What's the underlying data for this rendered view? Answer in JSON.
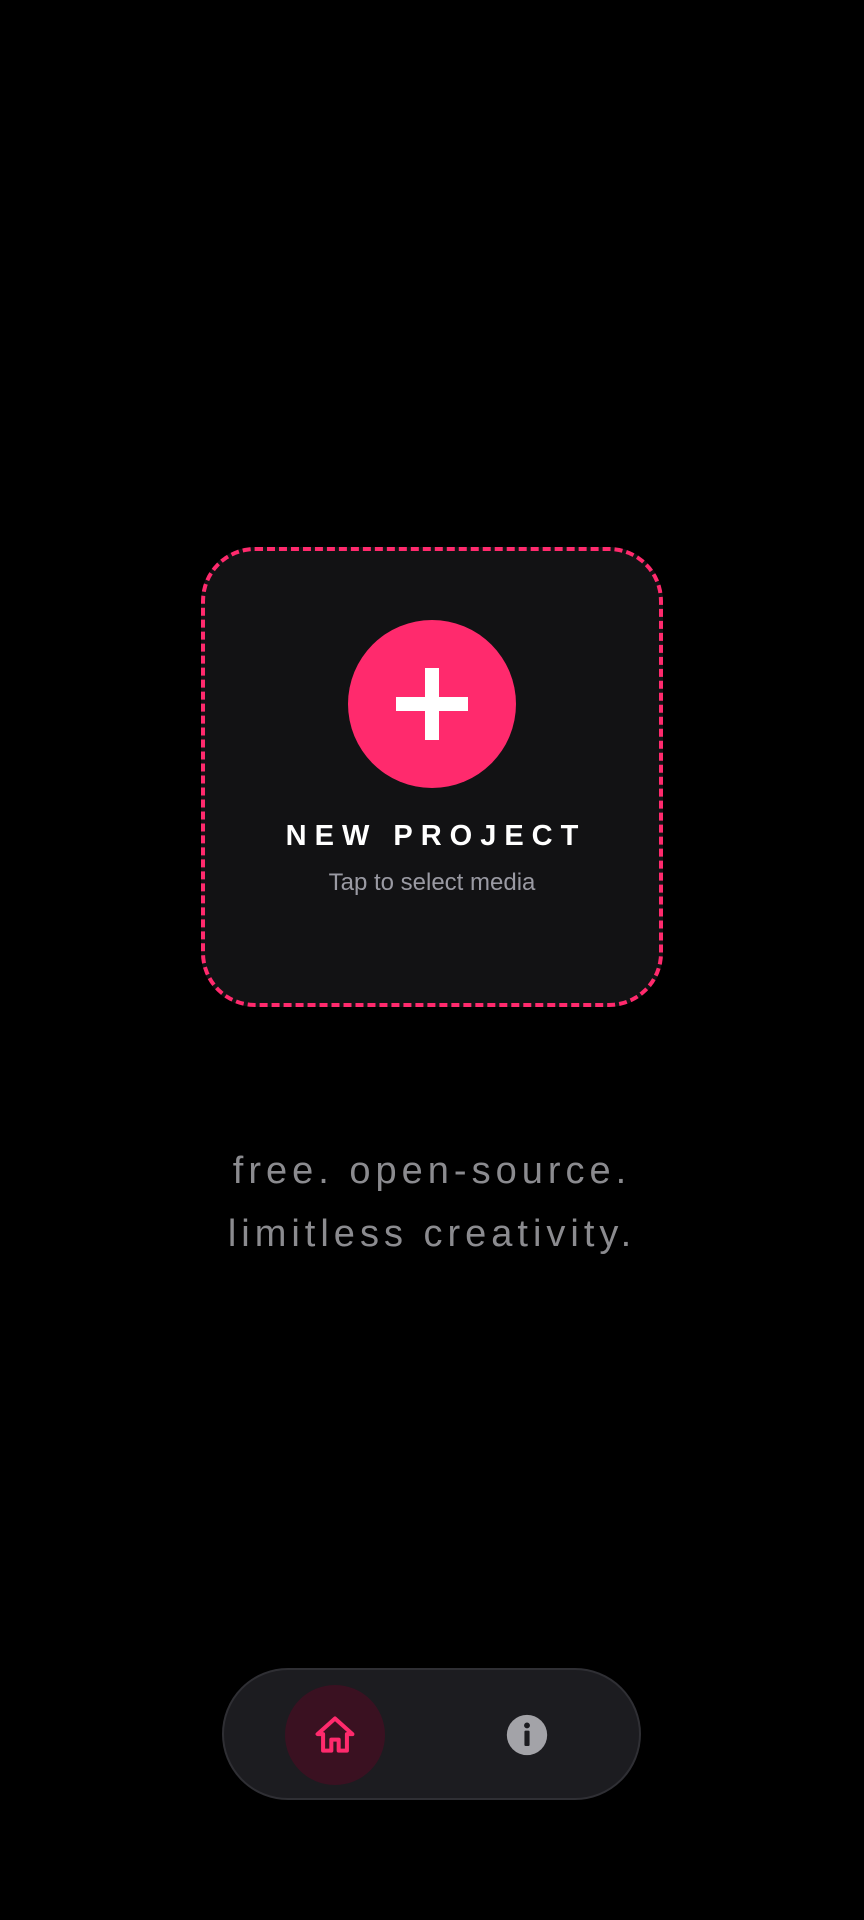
{
  "new_project": {
    "title": "NEW PROJECT",
    "subtitle": "Tap to select media",
    "icon": "plus-icon"
  },
  "tagline": {
    "line1": "free. open-source.",
    "line2": "limitless creativity."
  },
  "bottom_nav": {
    "items": [
      {
        "name": "home",
        "icon": "home-icon",
        "selected": true
      },
      {
        "name": "info",
        "icon": "info-icon",
        "selected": false
      }
    ]
  },
  "colors": {
    "accent": "#ff2a6d",
    "background": "#000000",
    "card_background": "#121214",
    "nav_background": "#1c1c20",
    "muted_text": "#8b8b8f"
  }
}
